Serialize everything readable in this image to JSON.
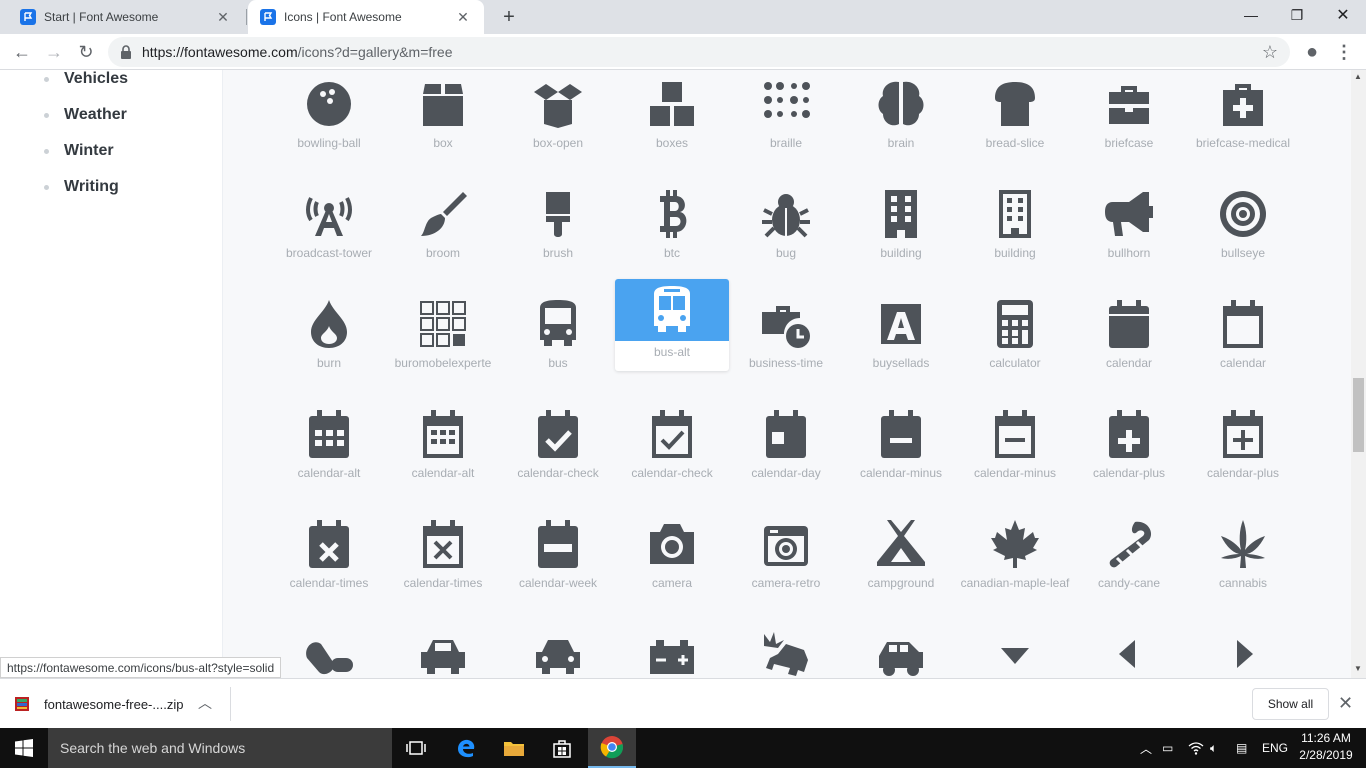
{
  "browser": {
    "tabs": [
      {
        "title": "Start | Font Awesome",
        "active": false
      },
      {
        "title": "Icons | Font Awesome",
        "active": true
      }
    ],
    "url_host": "https://fontawesome.com",
    "url_rest": "/icons?d=gallery&m=free"
  },
  "sidebar": {
    "categories": [
      "Vehicles",
      "Weather",
      "Winter",
      "Writing"
    ]
  },
  "icons": [
    [
      "bowling-ball",
      "box",
      "box-open",
      "boxes",
      "braille",
      "brain",
      "bread-slice",
      "briefcase",
      "briefcase-medical"
    ],
    [
      "broadcast-tower",
      "broom",
      "brush",
      "btc",
      "bug",
      "building",
      "building",
      "bullhorn",
      "bullseye"
    ],
    [
      "burn",
      "buromobelexperte",
      "bus",
      "bus-alt",
      "business-time",
      "buysellads",
      "calculator",
      "calendar",
      "calendar"
    ],
    [
      "calendar-alt",
      "calendar-alt",
      "calendar-check",
      "calendar-check",
      "calendar-day",
      "calendar-minus",
      "calendar-minus",
      "calendar-plus",
      "calendar-plus"
    ],
    [
      "calendar-times",
      "calendar-times",
      "calendar-week",
      "camera",
      "camera-retro",
      "campground",
      "canadian-maple-leaf",
      "candy-cane",
      "cannabis"
    ]
  ],
  "selected_icon": "bus-alt",
  "status_url": "https://fontawesome.com/icons/bus-alt?style=solid",
  "downloads": {
    "file": "fontawesome-free-....zip",
    "show_all": "Show all"
  },
  "taskbar": {
    "search_placeholder": "Search the web and Windows",
    "lang": "ENG",
    "time": "11:26 AM",
    "date": "2/28/2019"
  }
}
